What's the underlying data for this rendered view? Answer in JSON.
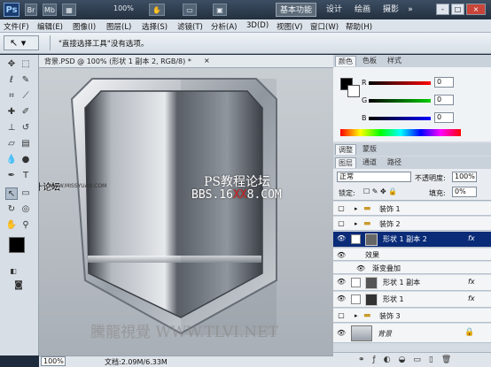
{
  "app": {
    "logo": "Ps",
    "tabs": [
      "Br",
      "Mb"
    ],
    "zoom": "100%",
    "workspaces": [
      "基本功能",
      "设计",
      "绘画",
      "摄影"
    ],
    "workspace_more": "»",
    "window_buttons": [
      "-",
      "□",
      "×"
    ]
  },
  "menu": [
    "文件(F)",
    "编辑(E)",
    "图像(I)",
    "图层(L)",
    "选择(S)",
    "滤镜(T)",
    "分析(A)",
    "3D(D)",
    "视图(V)",
    "窗口(W)",
    "帮助(H)"
  ],
  "options": {
    "message": "\"直接选择工具\"没有选项。"
  },
  "document": {
    "tab_title": "背景.PSD @ 100% (形状 1 副本 2, RGB/8) *",
    "close": "×",
    "zoom": "100%",
    "doc_info": "文档:2.09M/6.33M",
    "watermark_top_left": "思缘设计论坛",
    "watermark_top_left_url": "WWW.MISSYUAN.COM",
    "overlay_title": "PS教程论坛",
    "overlay_url_pre": "BBS.16",
    "overlay_url_mid": "XX",
    "overlay_url_post": "8.COM",
    "watermark_bottom": "騰龍視覺 WWW.TLVI.NET"
  },
  "color_panel": {
    "tabs": [
      "颜色",
      "色板",
      "样式"
    ],
    "channels": [
      {
        "label": "R",
        "value": "0"
      },
      {
        "label": "G",
        "value": "0"
      },
      {
        "label": "B",
        "value": "0"
      }
    ]
  },
  "adjust_tabs": [
    "调整",
    "蒙版"
  ],
  "layers_panel": {
    "tabs": [
      "图层",
      "通道",
      "路径"
    ],
    "blend_mode": "正常",
    "opacity_label": "不透明度:",
    "opacity": "100%",
    "lock_label": "锁定:",
    "fill_label": "填充:",
    "fill": "0%",
    "layers": [
      {
        "name": "装饰 1",
        "type": "group",
        "visible": false
      },
      {
        "name": "装饰 2",
        "type": "group",
        "visible": false
      },
      {
        "name": "形状 1 副本 2",
        "type": "shape",
        "visible": true,
        "selected": true,
        "fx": "fx"
      },
      {
        "name": "效果",
        "type": "effect-header",
        "visible": true
      },
      {
        "name": "渐变叠加",
        "type": "effect",
        "visible": true
      },
      {
        "name": "形状 1 副本",
        "type": "shape",
        "visible": true,
        "fx": "fx"
      },
      {
        "name": "形状 1",
        "type": "shape",
        "visible": true,
        "fx": "fx"
      },
      {
        "name": "装饰 3",
        "type": "group",
        "visible": false
      },
      {
        "name": "背景",
        "type": "background",
        "visible": true
      }
    ]
  },
  "colors": {
    "accent_selected": "#0a2b78",
    "foreground": "#000000",
    "background": "#ffffff",
    "overlay_red": "#cc2222"
  }
}
